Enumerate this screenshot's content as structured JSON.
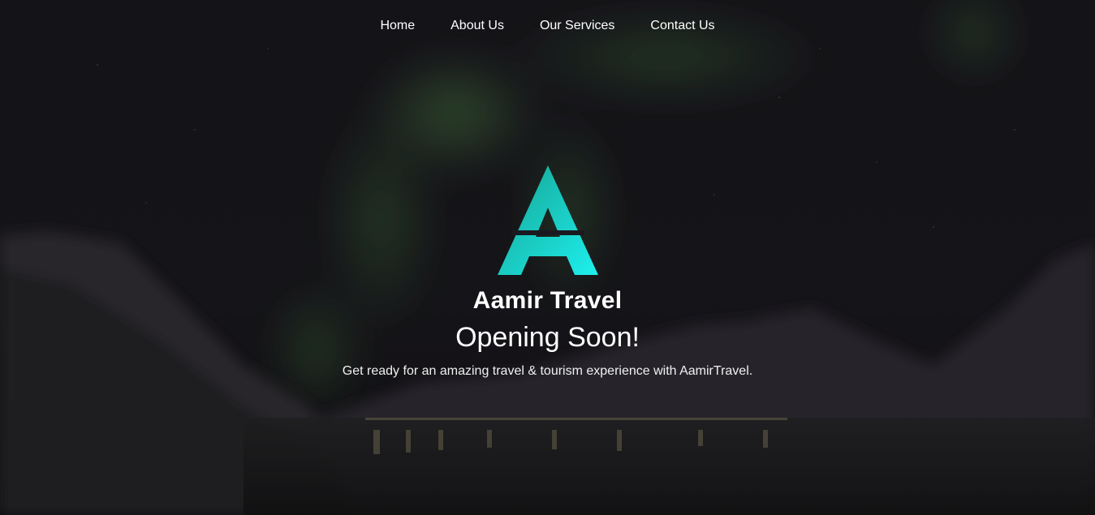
{
  "nav": {
    "items": [
      {
        "label": "Home"
      },
      {
        "label": "About Us"
      },
      {
        "label": "Our Services"
      },
      {
        "label": "Contact Us"
      }
    ]
  },
  "hero": {
    "brand": "Aamir Travel",
    "headline": "Opening Soon!",
    "subtitle": "Get ready for an amazing travel & tourism experience with AamirTravel."
  },
  "colors": {
    "logo_gradient_start": "#16a291",
    "logo_gradient_end": "#1ef0ee",
    "background": "#1b1a1f",
    "aurora": "#3f6a3a"
  },
  "icons": {
    "logo": "letter-a-triangle-logo"
  }
}
